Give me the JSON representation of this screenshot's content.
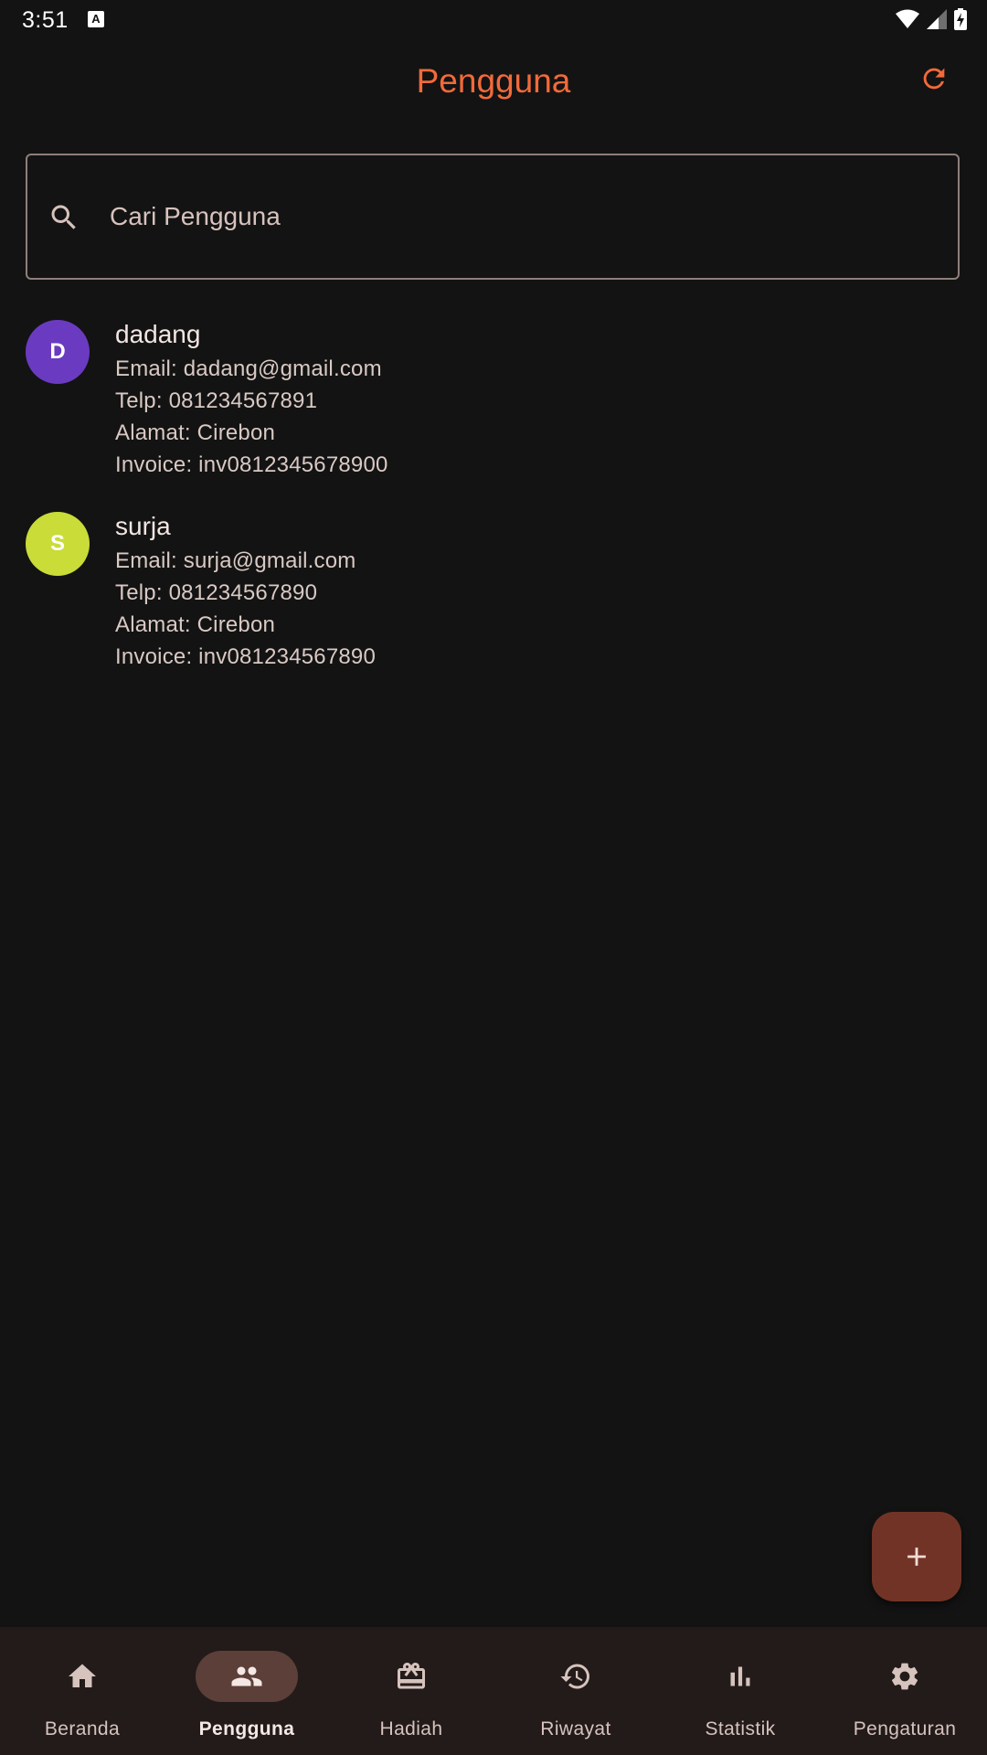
{
  "status_bar": {
    "time": "3:51",
    "notification_icon": "a-keyboard-icon",
    "icons": [
      "wifi-icon",
      "signal-icon",
      "battery-charging-icon"
    ]
  },
  "app_bar": {
    "title": "Pengguna",
    "title_color": "#f26a3a",
    "action_icon": "refresh-icon"
  },
  "search": {
    "placeholder": "Cari Pengguna",
    "value": "",
    "icon": "search-icon"
  },
  "users": [
    {
      "initial": "D",
      "avatar_color": "#6a3bc0",
      "name": "dadang",
      "email": "Email: dadang@gmail.com",
      "phone": "Telp: 081234567891",
      "address": "Alamat: Cirebon",
      "invoice": "Invoice: inv0812345678900"
    },
    {
      "initial": "S",
      "avatar_color": "#c9dc38",
      "name": "surja",
      "email": "Email: surja@gmail.com",
      "phone": "Telp: 081234567890",
      "address": "Alamat: Cirebon",
      "invoice": "Invoice: inv081234567890"
    }
  ],
  "fab": {
    "icon": "plus-icon",
    "color": "#723327"
  },
  "bottom_nav": {
    "active_index": 1,
    "items": [
      {
        "label": "Beranda",
        "icon": "home-icon"
      },
      {
        "label": "Pengguna",
        "icon": "people-icon"
      },
      {
        "label": "Hadiah",
        "icon": "gift-card-icon"
      },
      {
        "label": "Riwayat",
        "icon": "history-icon"
      },
      {
        "label": "Statistik",
        "icon": "bar-chart-icon"
      },
      {
        "label": "Pengaturan",
        "icon": "gear-icon"
      }
    ]
  }
}
